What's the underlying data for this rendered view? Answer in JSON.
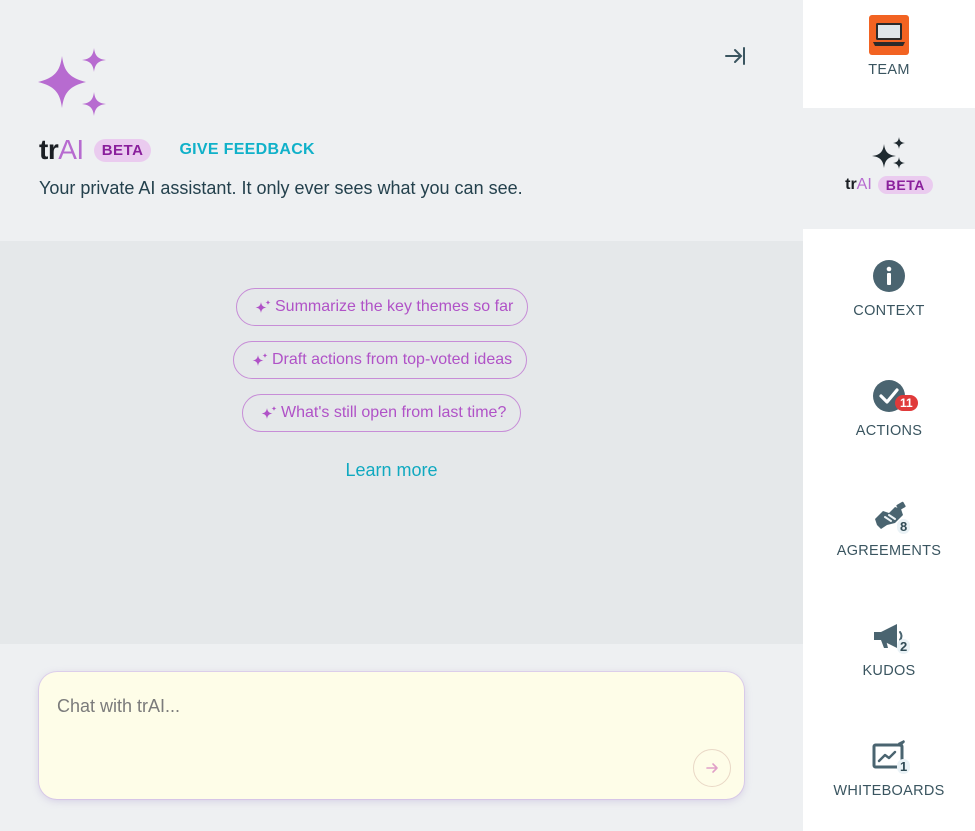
{
  "header": {
    "brand_prefix": "tr",
    "brand_suffix": "AI",
    "beta_label": "BETA",
    "feedback_label": "GIVE FEEDBACK",
    "subtitle": "Your private AI assistant. It only ever sees what you can see.",
    "logo_icon": "sparkles-icon",
    "collapse_icon": "collapse-right-icon"
  },
  "suggestions": [
    "Summarize the key themes so far",
    "Draft actions from top-voted ideas",
    "What's still open from last time?"
  ],
  "learn_more": "Learn more",
  "chat": {
    "placeholder": "Chat with trAI...",
    "send_icon": "arrow-right-icon"
  },
  "sidebar": {
    "items": [
      {
        "label": "TEAM",
        "icon": "laptop-icon"
      },
      {
        "brand_prefix": "tr",
        "brand_suffix": "AI",
        "beta_label": "BETA",
        "icon": "sparkles-icon"
      },
      {
        "label": "CONTEXT",
        "icon": "info-icon"
      },
      {
        "label": "ACTIONS",
        "icon": "check-circle-icon",
        "badge": "11"
      },
      {
        "label": "AGREEMENTS",
        "icon": "handshake-icon",
        "count": "8"
      },
      {
        "label": "KUDOS",
        "icon": "megaphone-icon",
        "count": "2"
      },
      {
        "label": "WHITEBOARDS",
        "icon": "whiteboard-icon",
        "count": "1"
      }
    ]
  },
  "colors": {
    "accent_purple": "#b76bd0",
    "accent_teal": "#10b1c9",
    "badge_red": "#e03a3a",
    "team_orange": "#f26322"
  }
}
